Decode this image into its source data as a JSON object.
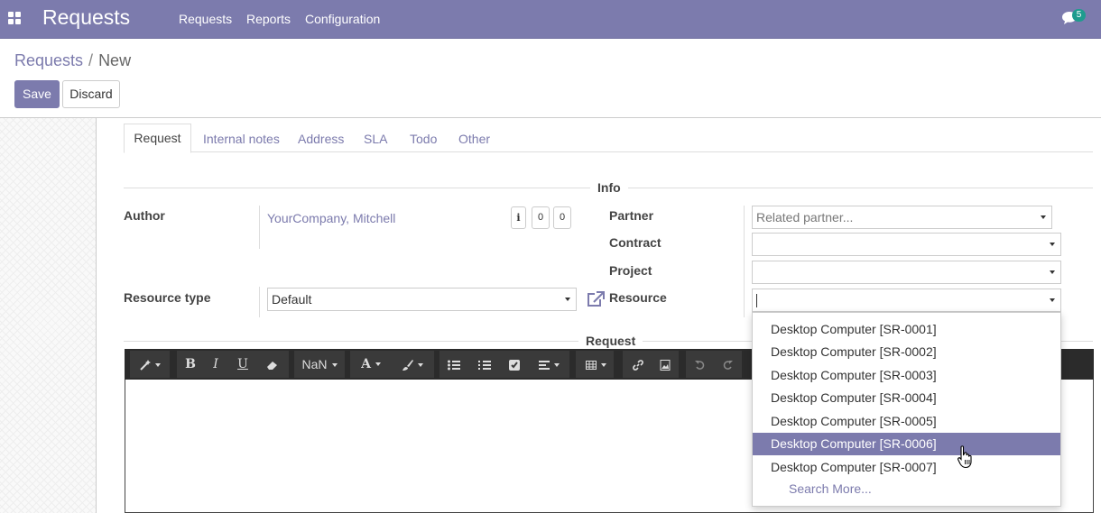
{
  "navbar": {
    "app_title": "Requests",
    "menu": [
      "Requests",
      "Reports",
      "Configuration"
    ],
    "chat_count": "5",
    "color": "#7c7bad"
  },
  "breadcrumb": {
    "parent": "Requests",
    "separator": "/",
    "current": "New"
  },
  "buttons": {
    "save": "Save",
    "discard": "Discard"
  },
  "tabs": [
    "Request",
    "Internal notes",
    "Address",
    "SLA",
    "Todo",
    "Other"
  ],
  "sections": {
    "info": "Info",
    "request": "Request"
  },
  "form": {
    "author_label": "Author",
    "author_value": "YourCompany, Mitchell",
    "author_buttons": [
      "i",
      "0",
      "0"
    ],
    "resource_type_label": "Resource type",
    "resource_type_value": "Default",
    "partner_label": "Partner",
    "partner_placeholder": "Related partner...",
    "contract_label": "Contract",
    "project_label": "Project",
    "resource_label": "Resource",
    "resource_value": ""
  },
  "editor": {
    "font_size": "NaN",
    "tools": [
      "magic-wand-icon",
      "bold-icon",
      "italic-icon",
      "underline-icon",
      "eraser-icon",
      "font-size-dropdown",
      "font-color-icon",
      "brush-icon",
      "unordered-list-icon",
      "ordered-list-icon",
      "checklist-icon",
      "align-icon",
      "table-icon",
      "link-icon",
      "image-icon",
      "undo-icon",
      "redo-icon"
    ]
  },
  "dropdown": {
    "items": [
      "Desktop Computer [SR-0001]",
      "Desktop Computer [SR-0002]",
      "Desktop Computer [SR-0003]",
      "Desktop Computer [SR-0004]",
      "Desktop Computer [SR-0005]",
      "Desktop Computer [SR-0006]",
      "Desktop Computer [SR-0007]"
    ],
    "active_index": 5,
    "search_more": "Search More..."
  }
}
